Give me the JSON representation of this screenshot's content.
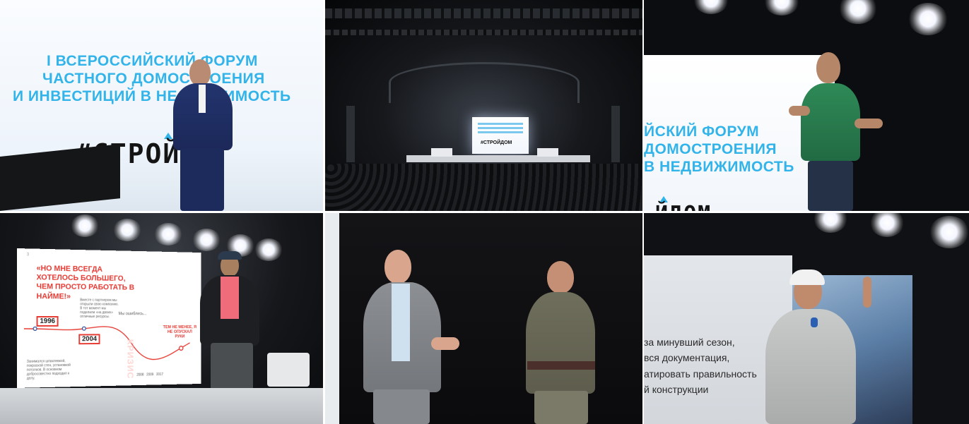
{
  "tiles": {
    "speaker_blue_suit": {
      "forum_line1": "I ВСЕРОССИЙСКИЙ ФОРУМ",
      "forum_line2": "ЧАСТНОГО ДОМОСТРОЕНИЯ",
      "forum_line3": "И ИНВЕСТИЦИЙ В НЕДВИЖИМОСТЬ",
      "logo": "#СТРОЙ"
    },
    "hall_overview": {
      "screen_logo": "#СТРОЙДОМ"
    },
    "speaker_green_shirt": {
      "forum_line1": "ЙСКИЙ ФОРУМ",
      "forum_line2": "ДОМОСТРОЕНИЯ",
      "forum_line3": "В НЕДВИЖИМОСТЬ",
      "logo": "ЙДОМ"
    },
    "speaker_slide": {
      "slide_number": "3",
      "quote": "«НО МНЕ ВСЕГДА ХОТЕЛОСЬ БОЛЬШЕГО, ЧЕМ ПРОСТО РАБОТАТЬ В НАЙМЕ!»",
      "year_1996": "1996",
      "year_2004": "2004",
      "note_together": "Вместе с партнером мы открыли свою компанию. В тот момент мы поделили «на двоих» отличные ресурсы.",
      "note_mistake": "Мы ошиблись...",
      "note_left": "Занимался шпаклевкой, покраской стен, установкой потолков. В основном добросовестно подходил к делу.",
      "crisis": "КРИЗИС",
      "red_text": "ТЕМ НЕ МЕНЕЕ, Я НЕ ОПУСКАЛ РУКИ",
      "years_bottom": "2008   2009   2017"
    },
    "two_speakers": {},
    "speaker_white_cap": {
      "season_text": "за минувший сезон,\nвся документация,\nатировать правильность\nй конструкции"
    }
  }
}
